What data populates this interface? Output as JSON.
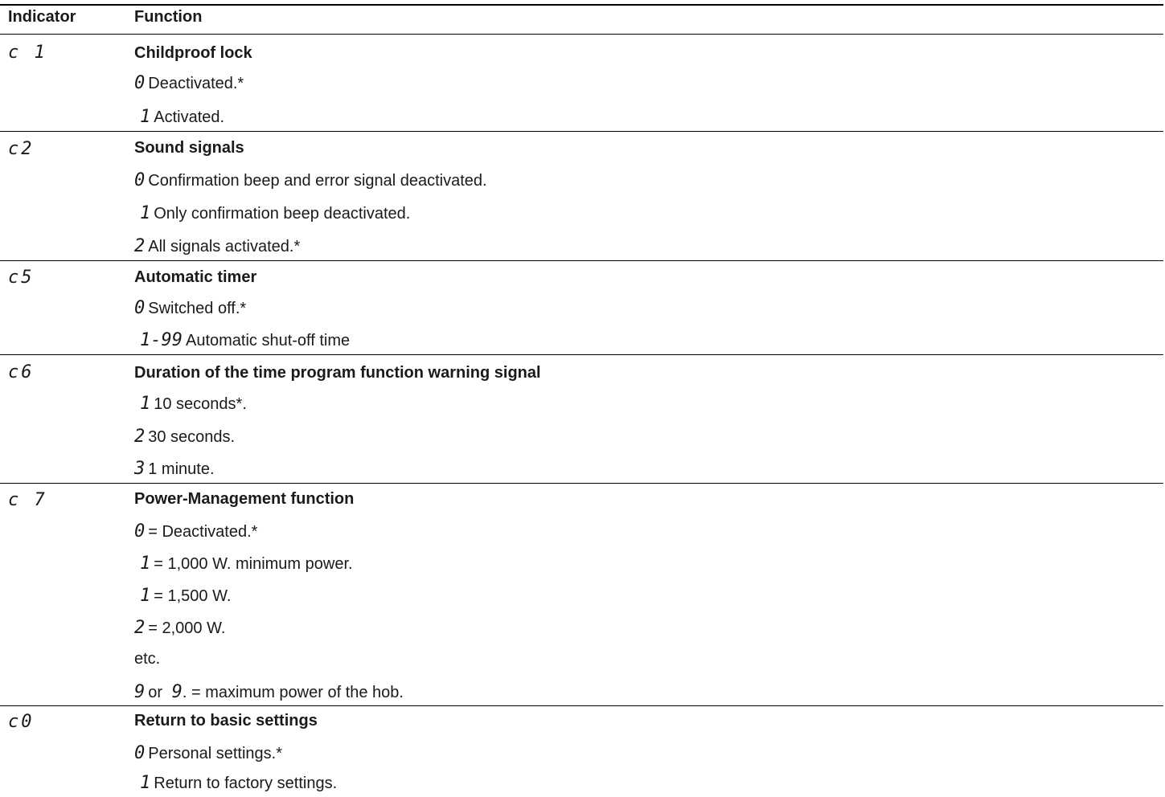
{
  "header": {
    "indicator_label": "Indicator",
    "function_label": "Function"
  },
  "rows": [
    {
      "code": "c 1",
      "title": "Childproof lock",
      "options": [
        {
          "value": "0",
          "text": "Deactivated.*"
        },
        {
          "value": "1",
          "text": "Activated."
        }
      ]
    },
    {
      "code": "c2",
      "title": "Sound signals",
      "options": [
        {
          "value": "0",
          "text": "Confirmation beep and error signal deactivated."
        },
        {
          "value": "1",
          "text": "Only confirmation beep deactivated."
        },
        {
          "value": "2",
          "text": "All signals activated.*"
        }
      ]
    },
    {
      "code": "c5",
      "title": "Automatic timer",
      "options": [
        {
          "value": "0",
          "text": "Switched off.*"
        },
        {
          "value": "1-99",
          "text": "Automatic shut-off time"
        }
      ]
    },
    {
      "code": "c6",
      "title": "Duration of the time program function warning signal",
      "options": [
        {
          "value": "1",
          "text": "10 seconds*."
        },
        {
          "value": "2",
          "text": "30 seconds."
        },
        {
          "value": "3",
          "text": "1 minute."
        }
      ]
    },
    {
      "code": "c 7",
      "title": "Power-Management function",
      "options": [
        {
          "value": "0",
          "text": "= Deactivated.*"
        },
        {
          "value": "1",
          "text": "= 1,000 W. minimum power."
        },
        {
          "value": "1",
          "text": "= 1,500 W."
        },
        {
          "value": "2",
          "text": "= 2,000 W."
        },
        {
          "value": "",
          "text": "etc."
        },
        {
          "value": "9",
          "text": "or",
          "value2": "9",
          "text2": ". = maximum power of the hob."
        }
      ]
    },
    {
      "code": "c0",
      "title": "Return to basic settings",
      "options": [
        {
          "value": "0",
          "text": "Personal settings.*"
        },
        {
          "value": "1",
          "text": "Return to factory settings."
        }
      ]
    }
  ]
}
